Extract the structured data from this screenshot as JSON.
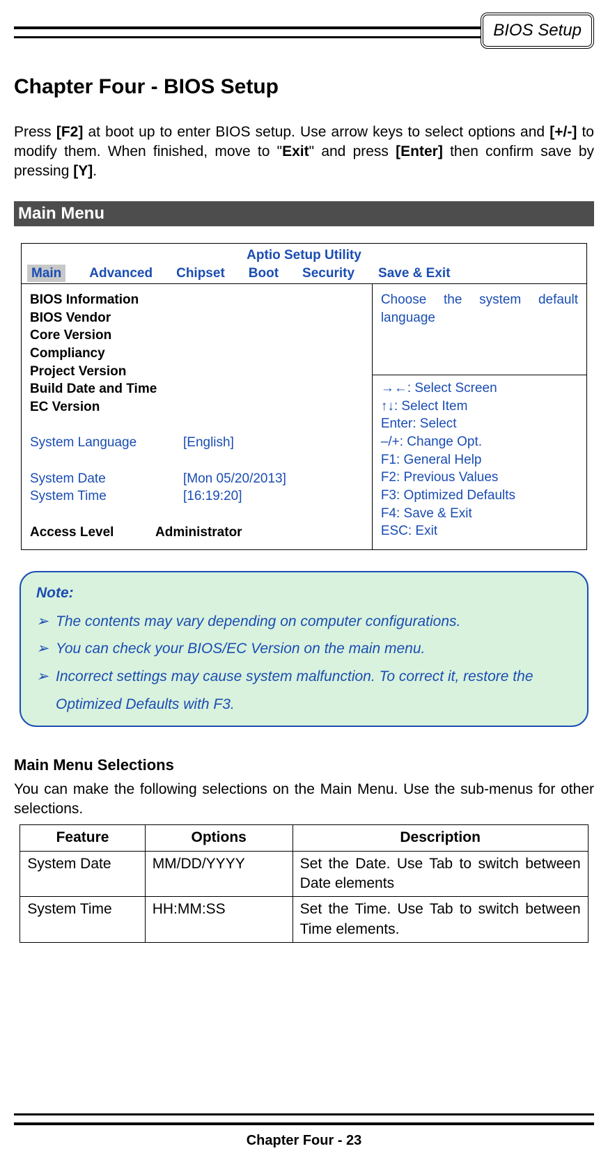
{
  "header": {
    "badge": "BIOS Setup"
  },
  "chapter_title": "Chapter Four - BIOS Setup",
  "intro": {
    "pre1": "Press ",
    "k1": "[F2]",
    "mid1": " at boot up to enter BIOS setup. Use arrow keys to select options and ",
    "k2": "[+/-]",
    "mid2": " to modify them. When finished, move to \"",
    "exit": "Exit",
    "mid3": "\" and press ",
    "k3": "[Enter]",
    "mid4": " then confirm save by pressing ",
    "k4": "[Y]",
    "end": "."
  },
  "section_bar": "Main Menu",
  "bios": {
    "utility_title": "Aptio Setup Utility",
    "tabs": {
      "main": "Main",
      "advanced": "Advanced",
      "chipset": "Chipset",
      "boot": "Boot",
      "security": "Security",
      "save_exit": "Save & Exit"
    },
    "left": {
      "heading": "BIOS Information",
      "vendor": "BIOS Vendor",
      "core": "Core Version",
      "compliancy": "Compliancy",
      "project": "Project Version",
      "build": "Build Date and Time",
      "ec": "EC Version",
      "lang_label": "System Language",
      "lang_value": "[English]",
      "date_label": "System Date",
      "date_value": "[Mon 05/20/2013]",
      "time_label": "System Time",
      "time_value": "[16:19:20]",
      "access_label": "Access Level",
      "access_value": "Administrator"
    },
    "help_top": "Choose the system default language",
    "help_keys": {
      "l1": "→←: Select Screen",
      "l2": "↑↓: Select Item",
      "l3": "Enter: Select",
      "l4": "–/+: Change Opt.",
      "l5": "F1: General Help",
      "l6": "F2: Previous Values",
      "l7": "F3: Optimized Defaults",
      "l8": "F4: Save & Exit",
      "l9": "ESC: Exit"
    }
  },
  "note": {
    "title": "Note:",
    "items": [
      "The contents may vary depending on computer configurations.",
      "You can check your BIOS/EC Version on the main menu.",
      "Incorrect settings may cause system malfunction. To correct it, restore the Optimized Defaults with F3."
    ]
  },
  "selections": {
    "heading": "Main Menu Selections",
    "para": "You can make the following selections on the Main Menu. Use the sub-menus for other selections.",
    "headers": {
      "feature": "Feature",
      "options": "Options",
      "description": "Description"
    },
    "rows": [
      {
        "feature": "System Date",
        "options": "MM/DD/YYYY",
        "description": "Set the Date. Use Tab to switch between Date elements"
      },
      {
        "feature": "System Time",
        "options": "HH:MM:SS",
        "description": "Set the Time. Use Tab to switch between Time elements."
      }
    ]
  },
  "footer": "Chapter Four - 23"
}
